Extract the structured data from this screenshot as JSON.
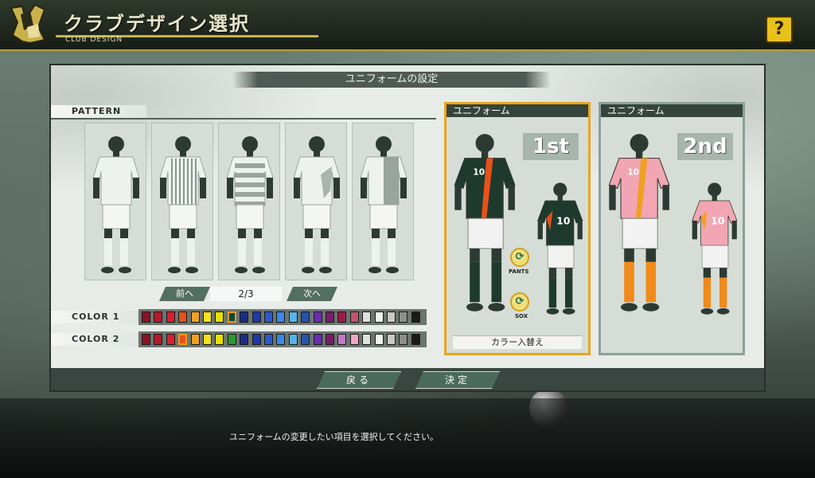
{
  "header": {
    "title": "クラブデザイン選択",
    "subtitle": "CLUB DESIGN",
    "help_label": "?"
  },
  "panel": {
    "section_title": "ユニフォームの設定",
    "pattern_label": "PATTERN",
    "patterns": [
      {
        "style": "plain"
      },
      {
        "style": "pinstripe"
      },
      {
        "style": "hoops"
      },
      {
        "style": "splash"
      },
      {
        "style": "half"
      }
    ],
    "pager": {
      "prev_label": "前へ",
      "page": "2/3",
      "next_label": "次へ"
    },
    "color1_label": "COLOR 1",
    "color2_label": "COLOR 2",
    "color1_swatches": [
      "#8a1426",
      "#b8182c",
      "#d8202a",
      "#e8501a",
      "#f0a020",
      "#f6e21c",
      "#e6e000",
      "#0d4a3e",
      "#1a2d86",
      "#1e3aa8",
      "#2a5ad0",
      "#3a8ae8",
      "#58b2ea",
      "#2a52a8",
      "#6a2cb0",
      "#7a1c6a",
      "#9c1c4e",
      "#c2566e",
      "#e0e0e0",
      "#f2f2f2",
      "#c8c8c8",
      "#8e8e8e",
      "#1a1a1a"
    ],
    "color1_selected": 7,
    "color2_swatches": [
      "#8a1426",
      "#b8182c",
      "#d8202a",
      "#e8501a",
      "#f0a020",
      "#f6e21c",
      "#e6e000",
      "#2a9a2e",
      "#1a2d86",
      "#1e3aa8",
      "#2a5ad0",
      "#3a8ae8",
      "#58b2ea",
      "#2a52a8",
      "#6a2cb0",
      "#7a1c6a",
      "#c078c8",
      "#f2a6c6",
      "#e0e0e0",
      "#f2f2f2",
      "#c8c8c8",
      "#8e8e8e",
      "#1a1a1a"
    ],
    "color2_selected": 3,
    "uniform_first": {
      "header": "ユニフォーム",
      "kit_label": "1st",
      "shirt_color": "#1e3a2e",
      "stripe_color": "#e8501a",
      "number": "10",
      "shorts_color": "#f2f2f2",
      "socks_color": "#1e3a2e",
      "pants_swap_label": "PANTS",
      "sox_swap_label": "SOX",
      "color_swap_label": "カラー入替え"
    },
    "uniform_second": {
      "header": "ユニフォーム",
      "kit_label": "2nd",
      "shirt_color": "#f2a6b4",
      "stripe_color": "#f0a020",
      "number": "10",
      "shorts_color": "#f2f2f2",
      "socks_color": "#f08a1a"
    },
    "back_label": "戻る",
    "confirm_label": "決定"
  },
  "message": "ユニフォームの変更したい項目を選択してください。"
}
